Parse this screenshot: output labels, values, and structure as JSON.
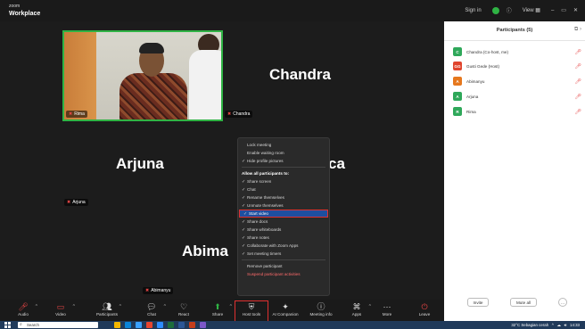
{
  "app": {
    "brand_top": "zoom",
    "brand_name": "Workplace"
  },
  "titlebar": {
    "sign_in": "Sign in",
    "view": "View",
    "view_icon": "grid-icon"
  },
  "stage": {
    "video_tag": "Rima",
    "video_tag2": "Chandra",
    "names": {
      "chandra": "Chandra",
      "arjuna": "Arjuna",
      "partial": "ca",
      "abima": "Abima"
    },
    "tags": {
      "arjuna": "Arjuna",
      "abimanyu": "Abimanyu"
    }
  },
  "host_menu": {
    "items": [
      {
        "label": "Lock meeting",
        "checked": false
      },
      {
        "label": "Enable waiting room",
        "checked": false
      },
      {
        "label": "Hide profile pictures",
        "checked": true
      }
    ],
    "section_title": "Allow all participants to:",
    "allow": [
      {
        "label": "Share screen",
        "checked": true
      },
      {
        "label": "Chat",
        "checked": true
      },
      {
        "label": "Rename themselves",
        "checked": true
      },
      {
        "label": "Unmute themselves",
        "checked": true
      },
      {
        "label": "Start video",
        "checked": true,
        "selected": true
      },
      {
        "label": "Share docs",
        "checked": true
      },
      {
        "label": "Share whiteboards",
        "checked": true
      },
      {
        "label": "Share notes",
        "checked": true
      },
      {
        "label": "Collaborate with Zoom Apps",
        "checked": true
      },
      {
        "label": "Set meeting timers",
        "checked": true
      }
    ],
    "remove": "Remove participant",
    "suspend": "Suspend participant activities"
  },
  "toolbar": {
    "items": [
      {
        "id": "audio",
        "label": "Audio",
        "icon": "mic-off-icon"
      },
      {
        "id": "video",
        "label": "Video",
        "icon": "video-off-icon"
      },
      {
        "id": "participants",
        "label": "Participants",
        "icon": "people-icon",
        "badge": "5"
      },
      {
        "id": "chat",
        "label": "Chat",
        "icon": "chat-icon"
      },
      {
        "id": "react",
        "label": "React",
        "icon": "heart-icon"
      },
      {
        "id": "share",
        "label": "Share",
        "icon": "share-icon"
      },
      {
        "id": "host-tools",
        "label": "Host tools",
        "icon": "shield-icon"
      },
      {
        "id": "ai",
        "label": "AI Companion",
        "icon": "sparkle-icon"
      },
      {
        "id": "info",
        "label": "Meeting info",
        "icon": "info-icon"
      },
      {
        "id": "apps",
        "label": "Apps",
        "icon": "apps-icon"
      },
      {
        "id": "more",
        "label": "More",
        "icon": "more-icon"
      },
      {
        "id": "leave",
        "label": "Leave",
        "icon": "leave-icon"
      }
    ]
  },
  "participants": {
    "title": "Participants (5)",
    "list": [
      {
        "initial": "C",
        "name": "Chandra (Co-host, me)",
        "color": "#2fa85a"
      },
      {
        "initial": "GG",
        "name": "Gusti Gede (Host)",
        "color": "#e0452e"
      },
      {
        "initial": "A",
        "name": "Abimanyu",
        "color": "#e6781e"
      },
      {
        "initial": "A",
        "name": "Arjuna",
        "color": "#2fa85a"
      },
      {
        "initial": "R",
        "name": "Rima",
        "color": "#2fa85a"
      }
    ],
    "invite": "Invite",
    "mute_all": "Mute all",
    "more": "..."
  },
  "taskbar": {
    "search": "Search",
    "weather": "32°C Sebagian cerah",
    "time": "14:33"
  },
  "colors": {
    "accent_green": "#2fb344",
    "danger": "#e03030",
    "selected_blue": "#1e4fa0"
  }
}
